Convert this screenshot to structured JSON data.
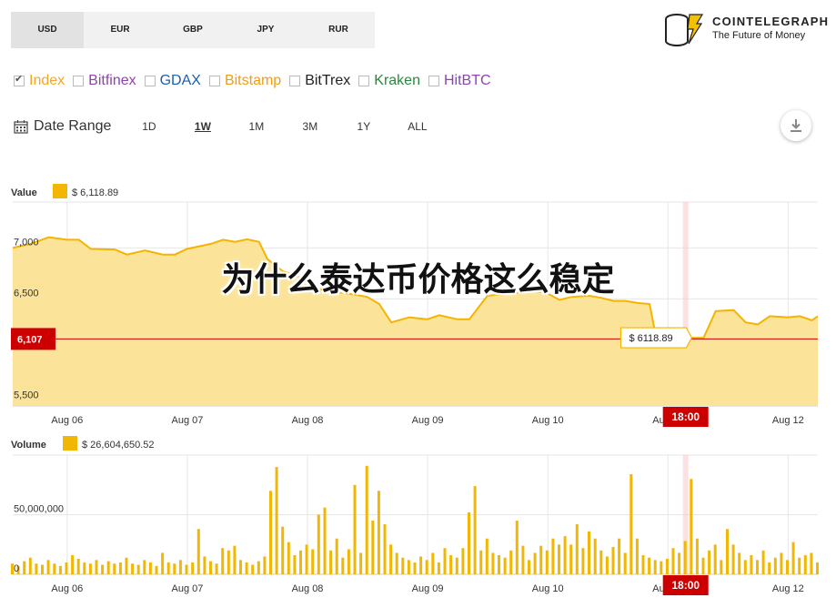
{
  "currency_tabs": [
    {
      "label": "USD",
      "active": true
    },
    {
      "label": "EUR",
      "active": false
    },
    {
      "label": "GBP",
      "active": false
    },
    {
      "label": "JPY",
      "active": false
    },
    {
      "label": "RUR",
      "active": false
    }
  ],
  "logo": {
    "title": "COINTELEGRAPH",
    "subtitle": "The Future of Money"
  },
  "exchanges": [
    {
      "label": "Index",
      "checked": true,
      "color": "#f5a623"
    },
    {
      "label": "Bitfinex",
      "checked": false,
      "color": "#8e44ad"
    },
    {
      "label": "GDAX",
      "checked": false,
      "color": "#1f5fa8"
    },
    {
      "label": "Bitstamp",
      "checked": false,
      "color": "#f39c12"
    },
    {
      "label": "BitTrex",
      "checked": false,
      "color": "#222222"
    },
    {
      "label": "Kraken",
      "checked": false,
      "color": "#27893c"
    },
    {
      "label": "HitBTC",
      "checked": false,
      "color": "#8e44ad"
    }
  ],
  "date_range": {
    "label": "Date Range",
    "options": [
      "1D",
      "1W",
      "1M",
      "3M",
      "1Y",
      "ALL"
    ],
    "active": "1W"
  },
  "overlay_title": "为什么泰达币价格这么稳定",
  "colors": {
    "area_fill": "#fbe49a",
    "line": "#f4b400",
    "volume_bar": "#f2b705",
    "marker": "#cc0000"
  },
  "chart_data": [
    {
      "type": "area",
      "series_label": "Value",
      "legend_value": "$ 6,118.89",
      "x_ticks": [
        "Aug 06",
        "Aug 07",
        "Aug 08",
        "Aug 09",
        "Aug 10",
        "Aug 11",
        "Aug 12"
      ],
      "y_ticks": [
        {
          "value": 5500,
          "label": "5,500"
        },
        {
          "value": 6500,
          "label": "6,500"
        },
        {
          "value": 7000,
          "label": "7,000"
        }
      ],
      "ylim": [
        5450,
        7450
      ],
      "x_range": [
        5.6,
        12.3
      ],
      "current_value": {
        "value": 6107,
        "label": "6,107"
      },
      "tooltip": {
        "label": "$ 6118.89",
        "x": 10.6,
        "value": 6118.89
      },
      "crosshair_x": 11.2,
      "crosshair_label": "18:00",
      "grid": true,
      "points": [
        [
          5.6,
          7000
        ],
        [
          5.75,
          7040
        ],
        [
          5.9,
          7105
        ],
        [
          6.05,
          7080
        ],
        [
          6.15,
          7080
        ],
        [
          6.25,
          6990
        ],
        [
          6.45,
          6985
        ],
        [
          6.55,
          6935
        ],
        [
          6.7,
          6975
        ],
        [
          6.85,
          6935
        ],
        [
          6.95,
          6935
        ],
        [
          7.05,
          6990
        ],
        [
          7.25,
          7040
        ],
        [
          7.35,
          7080
        ],
        [
          7.45,
          7060
        ],
        [
          7.55,
          7085
        ],
        [
          7.65,
          7060
        ],
        [
          7.72,
          6890
        ],
        [
          7.85,
          6770
        ],
        [
          7.95,
          6740
        ],
        [
          8.1,
          6620
        ],
        [
          8.25,
          6560
        ],
        [
          8.35,
          6560
        ],
        [
          8.45,
          6540
        ],
        [
          8.55,
          6520
        ],
        [
          8.65,
          6450
        ],
        [
          8.75,
          6270
        ],
        [
          8.9,
          6320
        ],
        [
          9.05,
          6300
        ],
        [
          9.15,
          6340
        ],
        [
          9.3,
          6300
        ],
        [
          9.4,
          6300
        ],
        [
          9.55,
          6530
        ],
        [
          9.7,
          6550
        ],
        [
          9.85,
          6565
        ],
        [
          9.95,
          6575
        ],
        [
          10.05,
          6555
        ],
        [
          10.15,
          6490
        ],
        [
          10.25,
          6520
        ],
        [
          10.4,
          6530
        ],
        [
          10.5,
          6510
        ],
        [
          10.6,
          6480
        ],
        [
          10.7,
          6480
        ],
        [
          10.8,
          6460
        ],
        [
          10.9,
          6450
        ],
        [
          10.95,
          6150
        ],
        [
          11.0,
          6100
        ],
        [
          11.05,
          6110
        ],
        [
          11.15,
          6110
        ],
        [
          11.25,
          6118.89
        ],
        [
          11.35,
          6120
        ],
        [
          11.45,
          6380
        ],
        [
          11.6,
          6390
        ],
        [
          11.7,
          6270
        ],
        [
          11.8,
          6250
        ],
        [
          11.9,
          6330
        ],
        [
          12.05,
          6320
        ],
        [
          12.15,
          6330
        ],
        [
          12.25,
          6290
        ],
        [
          12.3,
          6330
        ]
      ]
    },
    {
      "type": "bar",
      "series_label": "Volume",
      "legend_value": "$ 26,604,650.52",
      "x_ticks": [
        "Aug 06",
        "Aug 07",
        "Aug 08",
        "Aug 09",
        "Aug 10",
        "Aug 11",
        "Aug 12"
      ],
      "y_ticks": [
        {
          "value": 0,
          "label": "0"
        },
        {
          "value": 50000000,
          "label": "50,000,000"
        }
      ],
      "ylim": [
        0,
        100000000
      ],
      "x_range": [
        5.6,
        12.3
      ],
      "crosshair_x": 11.2,
      "crosshair_label": "18:00",
      "grid": true,
      "bar_width_days": 0.03,
      "bars": [
        [
          5.6,
          9
        ],
        [
          5.65,
          7
        ],
        [
          5.7,
          11
        ],
        [
          5.75,
          14
        ],
        [
          5.8,
          9
        ],
        [
          5.85,
          8
        ],
        [
          5.9,
          12
        ],
        [
          5.95,
          9
        ],
        [
          6.0,
          7
        ],
        [
          6.05,
          10
        ],
        [
          6.1,
          16
        ],
        [
          6.15,
          13
        ],
        [
          6.2,
          10
        ],
        [
          6.25,
          9
        ],
        [
          6.3,
          12
        ],
        [
          6.35,
          8
        ],
        [
          6.4,
          11
        ],
        [
          6.45,
          9
        ],
        [
          6.5,
          10
        ],
        [
          6.55,
          14
        ],
        [
          6.6,
          9
        ],
        [
          6.65,
          8
        ],
        [
          6.7,
          12
        ],
        [
          6.75,
          10
        ],
        [
          6.8,
          7
        ],
        [
          6.85,
          18
        ],
        [
          6.9,
          10
        ],
        [
          6.95,
          9
        ],
        [
          7.0,
          12
        ],
        [
          7.05,
          8
        ],
        [
          7.1,
          10
        ],
        [
          7.15,
          38
        ],
        [
          7.2,
          15
        ],
        [
          7.25,
          11
        ],
        [
          7.3,
          9
        ],
        [
          7.35,
          22
        ],
        [
          7.4,
          20
        ],
        [
          7.45,
          24
        ],
        [
          7.5,
          12
        ],
        [
          7.55,
          10
        ],
        [
          7.6,
          8
        ],
        [
          7.65,
          11
        ],
        [
          7.7,
          15
        ],
        [
          7.75,
          70
        ],
        [
          7.8,
          90
        ],
        [
          7.85,
          40
        ],
        [
          7.9,
          27
        ],
        [
          7.95,
          16
        ],
        [
          8.0,
          20
        ],
        [
          8.05,
          25
        ],
        [
          8.1,
          21
        ],
        [
          8.15,
          50
        ],
        [
          8.2,
          56
        ],
        [
          8.25,
          20
        ],
        [
          8.3,
          30
        ],
        [
          8.35,
          14
        ],
        [
          8.4,
          21
        ],
        [
          8.45,
          75
        ],
        [
          8.5,
          18
        ],
        [
          8.55,
          91
        ],
        [
          8.6,
          45
        ],
        [
          8.65,
          70
        ],
        [
          8.7,
          42
        ],
        [
          8.75,
          25
        ],
        [
          8.8,
          18
        ],
        [
          8.85,
          14
        ],
        [
          8.9,
          12
        ],
        [
          8.95,
          10
        ],
        [
          9.0,
          15
        ],
        [
          9.05,
          12
        ],
        [
          9.1,
          18
        ],
        [
          9.15,
          10
        ],
        [
          9.2,
          22
        ],
        [
          9.25,
          16
        ],
        [
          9.3,
          14
        ],
        [
          9.35,
          22
        ],
        [
          9.4,
          52
        ],
        [
          9.45,
          74
        ],
        [
          9.5,
          20
        ],
        [
          9.55,
          30
        ],
        [
          9.6,
          18
        ],
        [
          9.65,
          16
        ],
        [
          9.7,
          14
        ],
        [
          9.75,
          20
        ],
        [
          9.8,
          45
        ],
        [
          9.85,
          24
        ],
        [
          9.9,
          12
        ],
        [
          9.95,
          18
        ],
        [
          10.0,
          24
        ],
        [
          10.05,
          20
        ],
        [
          10.1,
          30
        ],
        [
          10.15,
          25
        ],
        [
          10.2,
          32
        ],
        [
          10.25,
          25
        ],
        [
          10.3,
          42
        ],
        [
          10.35,
          22
        ],
        [
          10.4,
          36
        ],
        [
          10.45,
          30
        ],
        [
          10.5,
          20
        ],
        [
          10.55,
          15
        ],
        [
          10.6,
          23
        ],
        [
          10.65,
          30
        ],
        [
          10.7,
          18
        ],
        [
          10.75,
          84
        ],
        [
          10.8,
          30
        ],
        [
          10.85,
          16
        ],
        [
          10.9,
          14
        ],
        [
          10.95,
          12
        ],
        [
          11.0,
          11
        ],
        [
          11.05,
          13
        ],
        [
          11.1,
          22
        ],
        [
          11.15,
          18
        ],
        [
          11.2,
          28
        ],
        [
          11.25,
          80
        ],
        [
          11.3,
          30
        ],
        [
          11.35,
          14
        ],
        [
          11.4,
          20
        ],
        [
          11.45,
          25
        ],
        [
          11.5,
          12
        ],
        [
          11.55,
          38
        ],
        [
          11.6,
          25
        ],
        [
          11.65,
          18
        ],
        [
          11.7,
          12
        ],
        [
          11.75,
          16
        ],
        [
          11.8,
          12
        ],
        [
          11.85,
          20
        ],
        [
          11.9,
          10
        ],
        [
          11.95,
          14
        ],
        [
          12.0,
          18
        ],
        [
          12.05,
          12
        ],
        [
          12.1,
          27
        ],
        [
          12.15,
          14
        ],
        [
          12.2,
          16
        ],
        [
          12.25,
          18
        ],
        [
          12.3,
          10
        ]
      ]
    }
  ]
}
